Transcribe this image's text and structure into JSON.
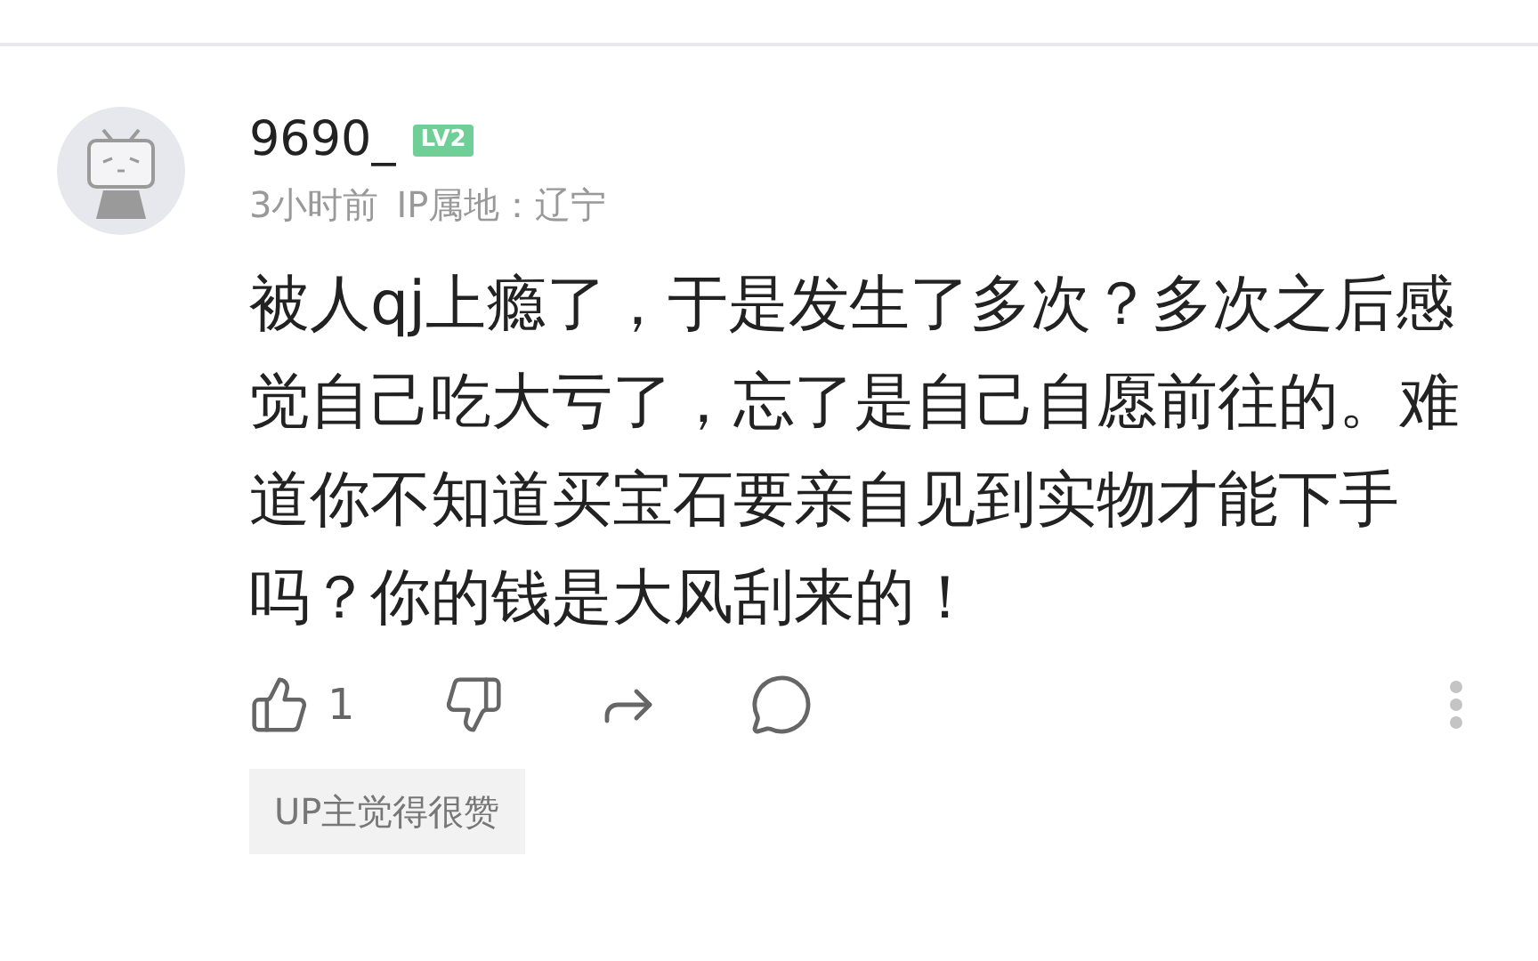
{
  "comment": {
    "username": "9690_",
    "level_badge": "LV2",
    "time": "3小时前",
    "ip_location": "IP属地：辽宁",
    "text": "被人qj上瘾了，于是发生了多次？多次之后感觉自己吃大亏了，忘了是自己自愿前往的。难道你不知道买宝石要亲自见到实物才能下手吗？你的钱是大风刮来的！",
    "like_count": "1",
    "tag": "UP主觉得很赞"
  }
}
